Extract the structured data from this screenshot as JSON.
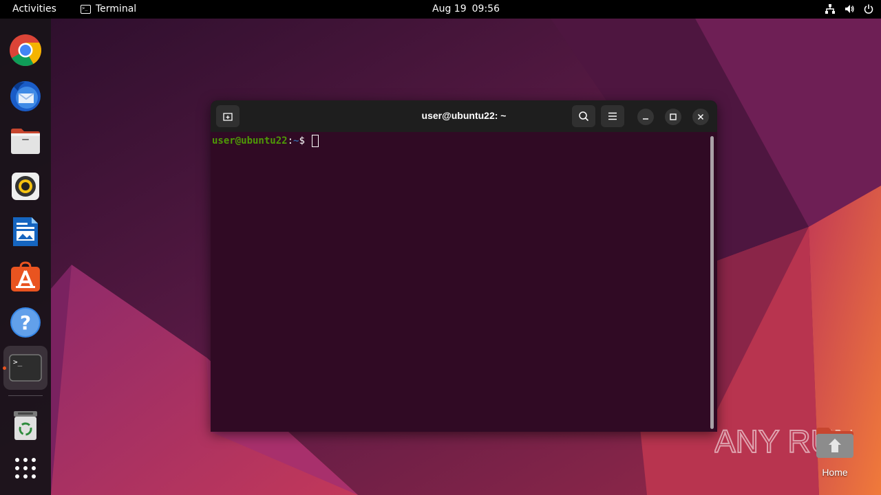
{
  "topbar": {
    "activities": "Activities",
    "app_name": "Terminal",
    "date": "Aug 19",
    "time": "09:56"
  },
  "dock": {
    "items": [
      {
        "name": "chrome",
        "icon": "chrome-icon"
      },
      {
        "name": "thunderbird",
        "icon": "thunderbird-icon"
      },
      {
        "name": "files",
        "icon": "files-icon"
      },
      {
        "name": "rhythmbox",
        "icon": "rhythmbox-icon"
      },
      {
        "name": "writer",
        "icon": "writer-icon"
      },
      {
        "name": "software",
        "icon": "software-icon"
      },
      {
        "name": "help",
        "icon": "help-icon"
      },
      {
        "name": "terminal",
        "icon": "terminal-icon",
        "active": true
      },
      {
        "name": "trash",
        "icon": "trash-icon"
      },
      {
        "name": "show-apps",
        "icon": "grid-icon"
      }
    ]
  },
  "terminal": {
    "title": "user@ubuntu22: ~",
    "prompt_user": "user@ubuntu22",
    "prompt_sep": ":",
    "prompt_path": "~",
    "prompt_symbol": "$ "
  },
  "desktop": {
    "home_label": "Home",
    "watermark": "ANY RUN"
  },
  "colors": {
    "accent": "#e95420",
    "terminal_bg": "#300a24",
    "prompt_green": "#4e9a06",
    "prompt_blue": "#3465a4"
  }
}
